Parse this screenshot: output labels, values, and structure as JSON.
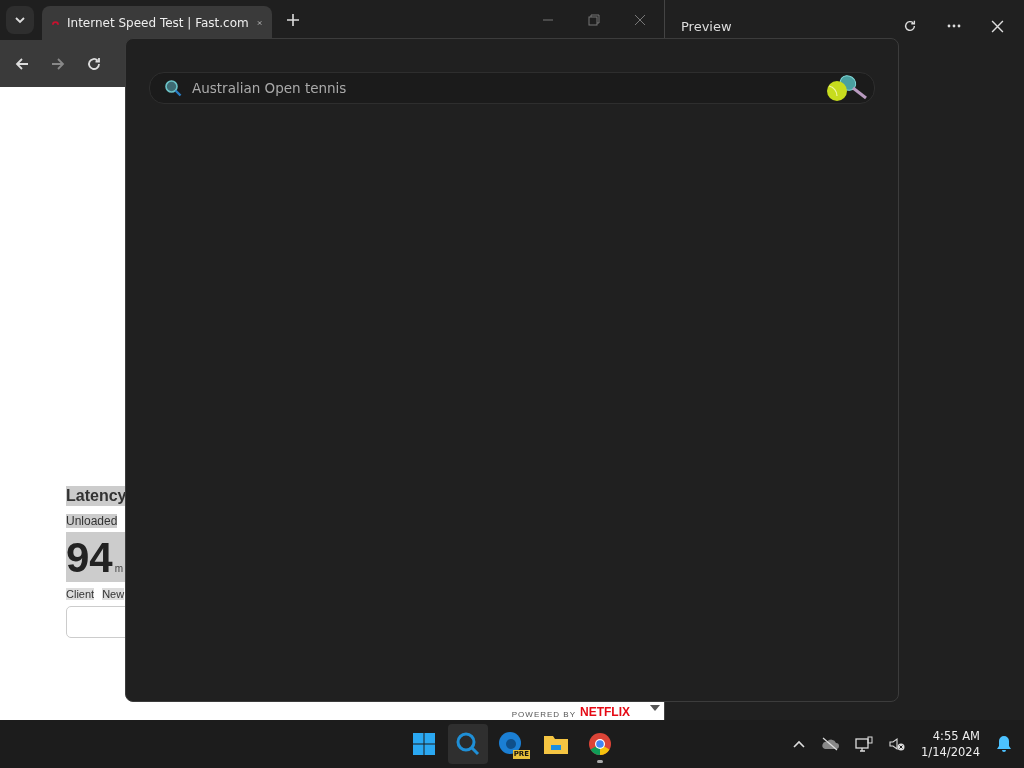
{
  "browser": {
    "tab": {
      "title": "Internet Speed Test | Fast.com",
      "selected": true
    },
    "page": {
      "latency_heading": "Latency",
      "unloaded_label": "Unloaded",
      "latency_value": "94",
      "unit": "m",
      "client_label": "Client",
      "column_2": "New",
      "powered_by": "POWERED BY",
      "brand": "NETFLIX"
    }
  },
  "preview_panel": {
    "title": "Preview"
  },
  "search": {
    "placeholder": "Australian Open tennis"
  },
  "taskbar": {
    "apps": [
      {
        "kind": "start",
        "selected": false,
        "running": false
      },
      {
        "kind": "search",
        "selected": true,
        "running": false
      },
      {
        "kind": "edge",
        "selected": false,
        "running": false,
        "badge": "PRE"
      },
      {
        "kind": "explorer",
        "selected": false,
        "running": false
      },
      {
        "kind": "chrome",
        "selected": false,
        "running": true
      }
    ],
    "clock": {
      "time": "4:55 AM",
      "date": "1/14/2024"
    }
  }
}
